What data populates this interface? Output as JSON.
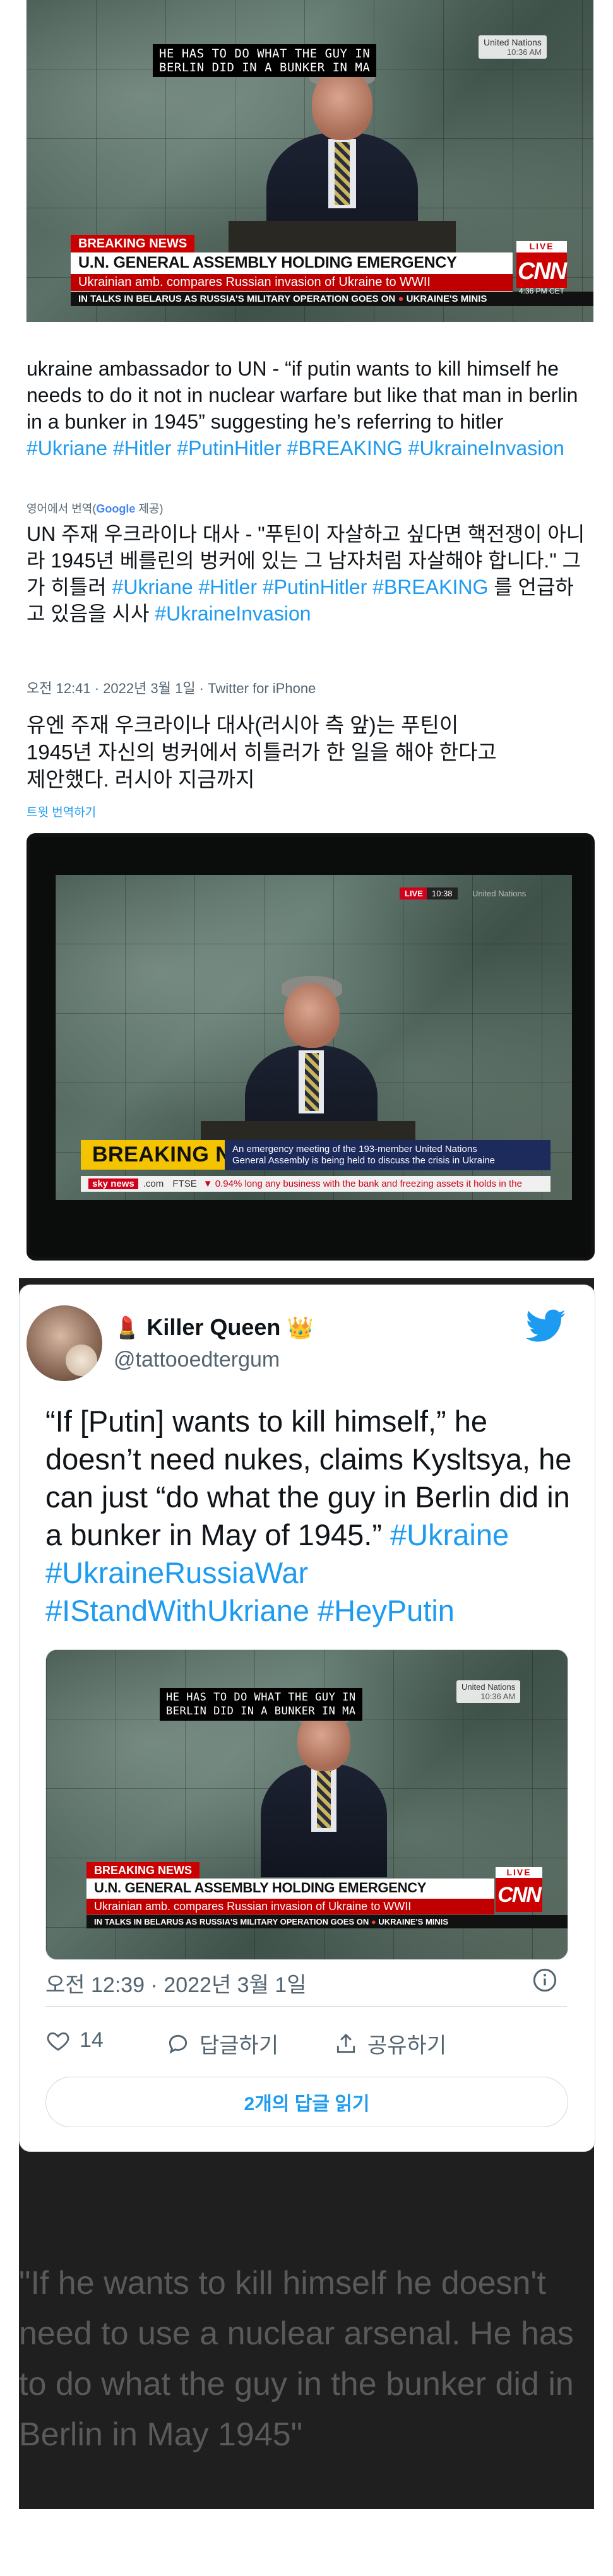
{
  "screenshot1": {
    "captions": [
      "HE HAS TO DO WHAT THE GUY IN",
      "BERLIN DID IN A BUNKER IN MA"
    ],
    "un_label": "United Nations",
    "un_time": "10:36 AM",
    "breaking": "BREAKING NEWS",
    "headline": "U.N. GENERAL ASSEMBLY HOLDING EMERGENCY SESSION",
    "subhead": "Ukrainian amb. compares Russian invasion of Ukraine to WWII",
    "ticker": "IN TALKS IN BELARUS AS RUSSIA'S MILITARY OPERATION GOES ON",
    "ticker_right": "UKRAINE'S MINIS",
    "live": "LIVE",
    "cnn": "CNN",
    "cnn_time": "4:36 PM CET"
  },
  "tweet1": {
    "text_en": "ukraine ambassador to UN - “if putin wants to kill himself he needs to do it not in nuclear warfare but like that man in berlin in a bunker in 1945” suggesting he’s referring to hitler",
    "tags_en": [
      "#Ukriane",
      "#Hitler",
      "#PutinHitler",
      "#BREAKING",
      "#UkraineInvasion"
    ],
    "translated_from": "영어에서 번역(",
    "google": "Google",
    "provided": "제공)",
    "text_ko": "UN 주재 우크라이나 대사 - \"푸틴이 자살하고 싶다면 핵전쟁이 아니라 1945년 베를린의 벙커에 있는 그 남자처럼 자살해야 합니다.\" 그가 히틀러",
    "tags_ko_1": [
      "#Ukriane",
      "#Hitler"
    ],
    "tags_ko_2": [
      "#PutinHitler",
      "#BREAKING"
    ],
    "text_ko_end": "를 언급하고 있음을 시사",
    "tag_ko_3": "#UkraineInvasion",
    "meta": "오전 12:41 · 2022년 3월 1일 · Twitter for iPhone"
  },
  "reply": {
    "line1": "유엔 주재 우크라이나 대사(러시아 측 앞)는 푸틴이",
    "line2": "1945년 자신의 벙커에서 히틀러가 한 일을 해야 한다고",
    "line3": "제안했다. 러시아 지금까지",
    "translate_link": "트윗 번역하기"
  },
  "screenshot2": {
    "live": "LIVE",
    "time": "10:38",
    "un_label": "United Nations",
    "breaking": "BREAKING NEWS",
    "desc_line1": "An emergency meeting of the 193-member United Nations",
    "desc_line2": "General Assembly is being held to discuss the crisis in Ukraine",
    "sky": "sky news",
    "site": ".com",
    "ftse": "FTSE",
    "ftse_val": "▼ 0.94%",
    "scroll": "long any business with the bank and freezing assets it holds in the"
  },
  "card": {
    "name": "Killer Queen",
    "handle": "@tattooedtergum",
    "body_text": "“If [Putin] wants to kill himself,” he doesn’t need nukes, claims Kysltsya, he can just “do what the guy in Berlin did in a bunker in May of 1945.”",
    "tags": [
      "#Ukraine",
      "#UkraineRussiaWar",
      "#IStandWithUkriane",
      "#HeyPutin"
    ],
    "time": "오전 12:39 · 2022년 3월 1일",
    "likes": "14",
    "reply_label": "답글하기",
    "share_label": "공유하기",
    "read_replies": "2개의 답글 읽기"
  },
  "quote": "\"If he wants to kill himself he doesn't need to use a nuclear arsenal. He has to do what the guy in the bunker did in Berlin in May 1945\"",
  "colors": {
    "twitter_blue": "#1d9bf0",
    "cnn_red": "#cc0000",
    "sky_yellow": "#f4c400"
  }
}
